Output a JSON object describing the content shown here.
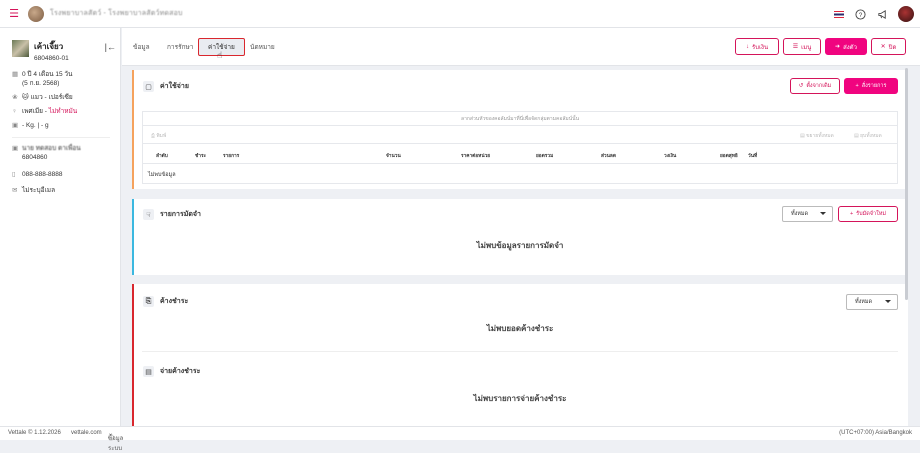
{
  "header": {
    "clinic_name": "โรงพยาบาลสัตว์ - โรงพยาบาลสัตว์ทดสอบ"
  },
  "pet": {
    "name": "เค้าเจี๊ยว",
    "id": "6804860-01",
    "age": "0 ปี 4 เดือน 15 วัน",
    "birthdate": "(5 ก.ย. 2568)",
    "species": "แมว - เปอร์เซีย",
    "sex_label": "เพศเมีย - ",
    "sex_status": "ไม่ทำหมัน",
    "weight": "- Kg. | - g"
  },
  "owner": {
    "name": "นาย ทดสอบ ตาเพื่อน",
    "id": "6804860",
    "phone": "088-888-8888",
    "email": "ไม่ระบุอีเมล"
  },
  "tabs": [
    "ข้อมูล",
    "การรักษา",
    "ค่าใช้จ่าย",
    "นัดหมาย"
  ],
  "active_tab_index": 2,
  "toolbar": {
    "receive": "รับเงิน",
    "menu": "เมนู",
    "send": "ส่งตัว",
    "close": "ปิด"
  },
  "expenses": {
    "title": "ค่าใช้จ่าย",
    "history_button": "ตั้งจากเดิม",
    "add_button": "สั่งรายการ",
    "drop_hint": "ลากส่วนหัวของคอลัมน์มาที่นี่เพื่อจัดกลุ่มตามคอลัมน์นั้น",
    "print": "พิมพ์",
    "expand_all": "ขยายทั้งหมด",
    "collapse_all": "ยุบทั้งหมด",
    "columns": [
      "ลำดับ",
      "ชำระ",
      "รายการ",
      "จำนวน",
      "ราคาต่อหน่วย",
      "ยอดรวม",
      "ส่วนลด",
      "วงเงิน",
      "ยอดสุทธิ",
      "วันที่"
    ],
    "no_data": "ไม่พบข้อมูล"
  },
  "deposits": {
    "title": "รายการมัดจำ",
    "filter": "ทั้งหมด",
    "add_button": "รับมัดจำใหม่",
    "empty": "ไม่พบข้อมูลรายการมัดจำ"
  },
  "outstanding": {
    "title": "ค้างชำระ",
    "filter": "ทั้งหมด",
    "empty": "ไม่พบยอดค้างชำระ"
  },
  "outstanding_payments": {
    "title": "จ่ายค้างชำระ",
    "empty": "ไม่พบรายการจ่ายค้างชำระ"
  },
  "footer": {
    "copyright": "Vettale © 1.12.2026",
    "site": "vettale.com",
    "system_info": "ข้อมูลระบบ",
    "timezone": "(UTC+07:00) Asia/Bangkok"
  },
  "colors": {
    "accent": "#f0047f",
    "expenses_bar": "#f5a25d",
    "deposits_bar": "#3bb8e0",
    "outstanding_bar": "#d9272e"
  }
}
